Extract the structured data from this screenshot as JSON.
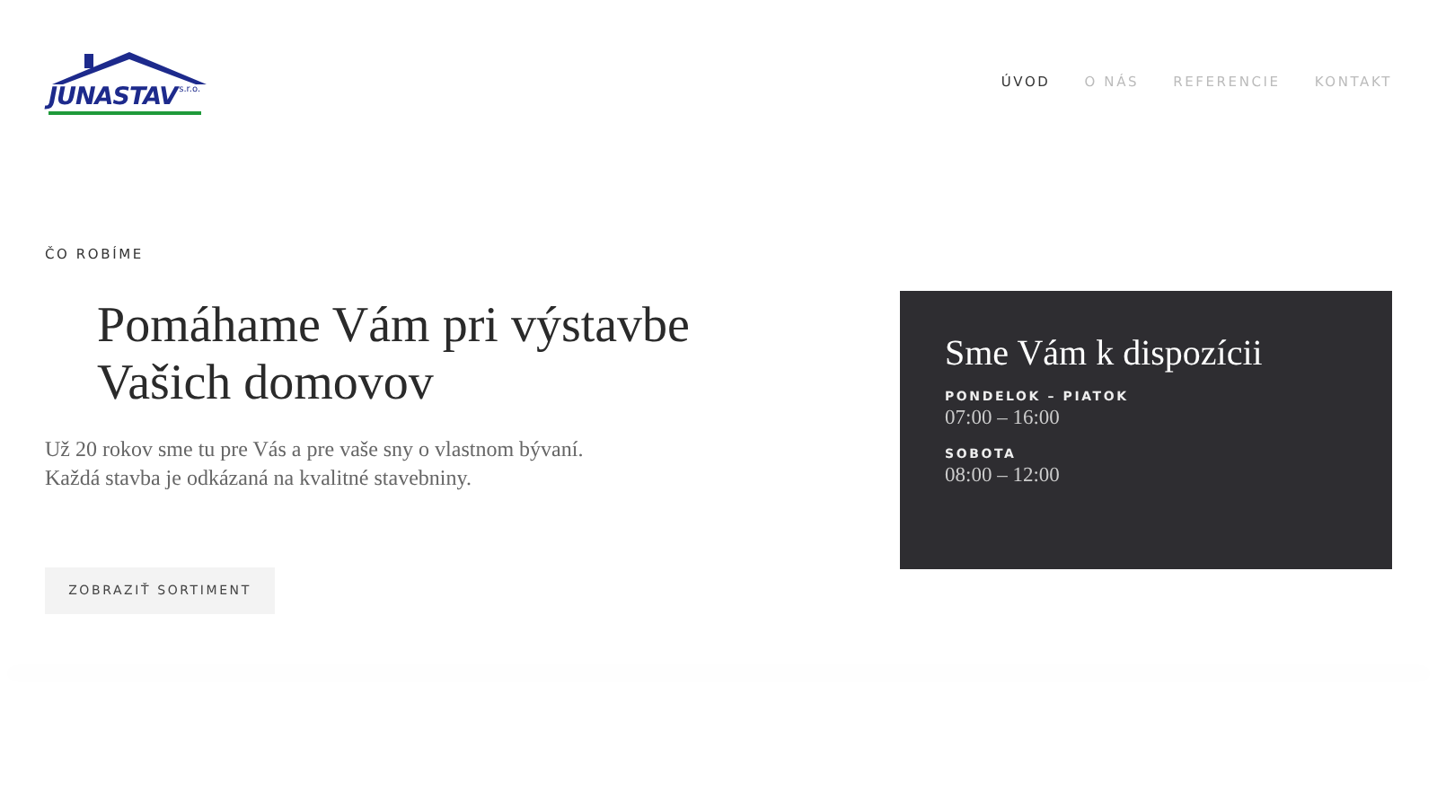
{
  "logo": {
    "name": "JUNASTAV",
    "suffix": "s.r.o."
  },
  "nav": [
    {
      "label": "ÚVOD",
      "selected": true
    },
    {
      "label": "O NÁS",
      "selected": false
    },
    {
      "label": "REFERENCIE",
      "selected": false
    },
    {
      "label": "KONTAKT",
      "selected": false
    }
  ],
  "hero": {
    "eyebrow": "ČO ROBÍME",
    "heading_lines": [
      "Pomáhame Vám pri výstavbe",
      "Vašich domovov"
    ],
    "text_lines": [
      "Už 20 rokov sme tu pre Vás a pre vaše sny o vlastnom bývaní.",
      "Každá stavba je odkázaná na kvalitné stavebniny."
    ],
    "button": "ZOBRAZIŤ SORTIMENT"
  },
  "hours_card": {
    "title": "Sme Vám k dispozícii",
    "entries": [
      {
        "day": "PONDELOK – PIATOK",
        "time": "07:00 – 16:00"
      },
      {
        "day": "SOBOTA",
        "time": "08:00 – 12:00"
      }
    ]
  }
}
